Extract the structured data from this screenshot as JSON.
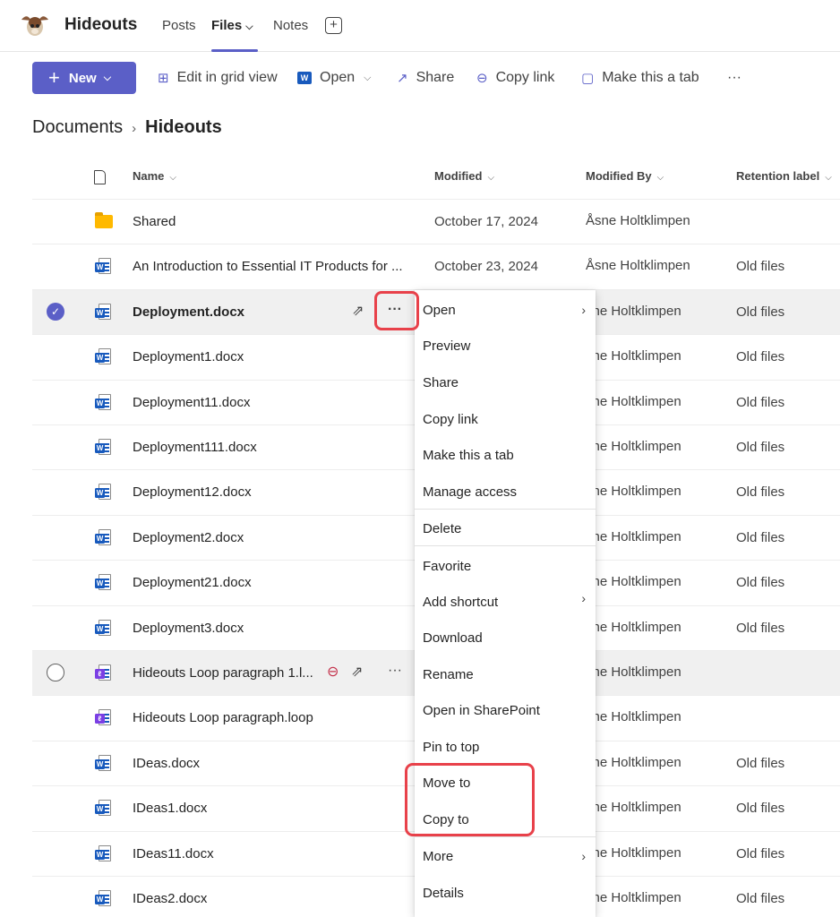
{
  "header": {
    "team_name": "Hideouts",
    "tabs": [
      {
        "label": "Posts"
      },
      {
        "label": "Files"
      },
      {
        "label": "Notes"
      }
    ],
    "add_tab_icon": "plus-square-icon"
  },
  "toolbar": {
    "new_label": "New",
    "edit_grid_label": "Edit in grid view",
    "open_label": "Open",
    "share_label": "Share",
    "copy_link_label": "Copy link",
    "make_tab_label": "Make this a tab",
    "more_label": "···",
    "accent_color": "#5b5fc7"
  },
  "breadcrumb": {
    "root": "Documents",
    "current": "Hideouts"
  },
  "columns": {
    "name": "Name",
    "modified": "Modified",
    "modified_by": "Modified By",
    "retention": "Retention label"
  },
  "files": [
    {
      "name": "Shared",
      "modified": "October 17, 2024",
      "modified_by": "Åsne Holtklimpen",
      "retention": "",
      "type": "folder"
    },
    {
      "name": "An Introduction to Essential IT Products for ...",
      "modified": "October 23, 2024",
      "modified_by": "Åsne Holtklimpen",
      "retention": "Old files",
      "type": "word"
    },
    {
      "name": "Deployment.docx",
      "modified": "",
      "modified_by": "sne Holtklimpen",
      "retention": "Old files",
      "type": "word",
      "selected": true
    },
    {
      "name": "Deployment1.docx",
      "modified": "",
      "modified_by": "sne Holtklimpen",
      "retention": "Old files",
      "type": "word"
    },
    {
      "name": "Deployment11.docx",
      "modified": "",
      "modified_by": "sne Holtklimpen",
      "retention": "Old files",
      "type": "word"
    },
    {
      "name": "Deployment111.docx",
      "modified": "",
      "modified_by": "sne Holtklimpen",
      "retention": "Old files",
      "type": "word"
    },
    {
      "name": "Deployment12.docx",
      "modified": "",
      "modified_by": "sne Holtklimpen",
      "retention": "Old files",
      "type": "word"
    },
    {
      "name": "Deployment2.docx",
      "modified": "",
      "modified_by": "sne Holtklimpen",
      "retention": "Old files",
      "type": "word"
    },
    {
      "name": "Deployment21.docx",
      "modified": "",
      "modified_by": "sne Holtklimpen",
      "retention": "Old files",
      "type": "word"
    },
    {
      "name": "Deployment3.docx",
      "modified": "",
      "modified_by": "sne Holtklimpen",
      "retention": "Old files",
      "type": "word"
    },
    {
      "name": "Hideouts Loop paragraph 1.l...",
      "modified": "",
      "modified_by": "sne Holtklimpen",
      "retention": "",
      "type": "loop",
      "hover": true
    },
    {
      "name": "Hideouts Loop paragraph.loop",
      "modified": "",
      "modified_by": "sne Holtklimpen",
      "retention": "",
      "type": "loop"
    },
    {
      "name": "IDeas.docx",
      "modified": "",
      "modified_by": "sne Holtklimpen",
      "retention": "Old files",
      "type": "word"
    },
    {
      "name": "IDeas1.docx",
      "modified": "",
      "modified_by": "sne Holtklimpen",
      "retention": "Old files",
      "type": "word"
    },
    {
      "name": "IDeas11.docx",
      "modified": "",
      "modified_by": "sne Holtklimpen",
      "retention": "Old files",
      "type": "word"
    },
    {
      "name": "IDeas2.docx",
      "modified": "",
      "modified_by": "sne Holtklimpen",
      "retention": "Old files",
      "type": "word"
    }
  ],
  "context_menu": {
    "items": [
      {
        "label": "Open",
        "submenu": true
      },
      {
        "label": "Preview"
      },
      {
        "label": "Share"
      },
      {
        "label": "Copy link"
      },
      {
        "label": "Make this a tab"
      },
      {
        "label": "Manage access"
      },
      {
        "label": "Delete"
      },
      {
        "label": "Favorite"
      },
      {
        "label": "Add shortcut",
        "submenu": true
      },
      {
        "label": "Download"
      },
      {
        "label": "Rename"
      },
      {
        "label": "Open in SharePoint"
      },
      {
        "label": "Pin to top"
      },
      {
        "label": "Move to"
      },
      {
        "label": "Copy to"
      },
      {
        "label": "More",
        "submenu": true
      },
      {
        "label": "Details"
      }
    ],
    "highlight_color": "#e8414a"
  }
}
